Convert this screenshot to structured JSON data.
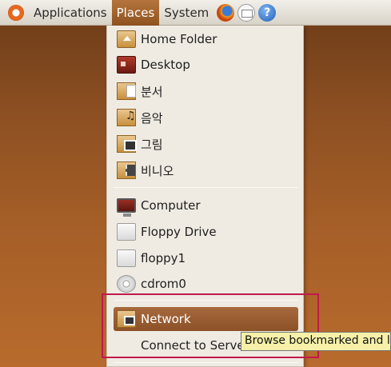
{
  "panel": {
    "menus": [
      {
        "label": "Applications"
      },
      {
        "label": "Places"
      },
      {
        "label": "System"
      }
    ],
    "help_glyph": "?"
  },
  "places_menu": {
    "items": [
      {
        "label": "Home Folder",
        "icon": "home-folder-icon"
      },
      {
        "label": "Desktop",
        "icon": "desktop-icon"
      },
      {
        "label": "분서",
        "icon": "documents-folder-icon"
      },
      {
        "label": "음악",
        "icon": "music-folder-icon"
      },
      {
        "label": "그림",
        "icon": "pictures-folder-icon"
      },
      {
        "label": "비니오",
        "icon": "videos-folder-icon"
      },
      {
        "label": "Computer",
        "icon": "computer-icon"
      },
      {
        "label": "Floppy Drive",
        "icon": "floppy-icon"
      },
      {
        "label": "floppy1",
        "icon": "floppy-icon"
      },
      {
        "label": "cdrom0",
        "icon": "cdrom-icon"
      },
      {
        "label": "Network",
        "icon": "network-icon"
      },
      {
        "label": "Connect to Server",
        "icon": ""
      }
    ],
    "highlighted_item": "Network"
  },
  "tooltip": {
    "text": "Browse bookmarked and l"
  },
  "colors": {
    "highlight": "#8c5127",
    "annotation_box": "#c0194d",
    "tooltip_bg": "#f6f0a8"
  }
}
